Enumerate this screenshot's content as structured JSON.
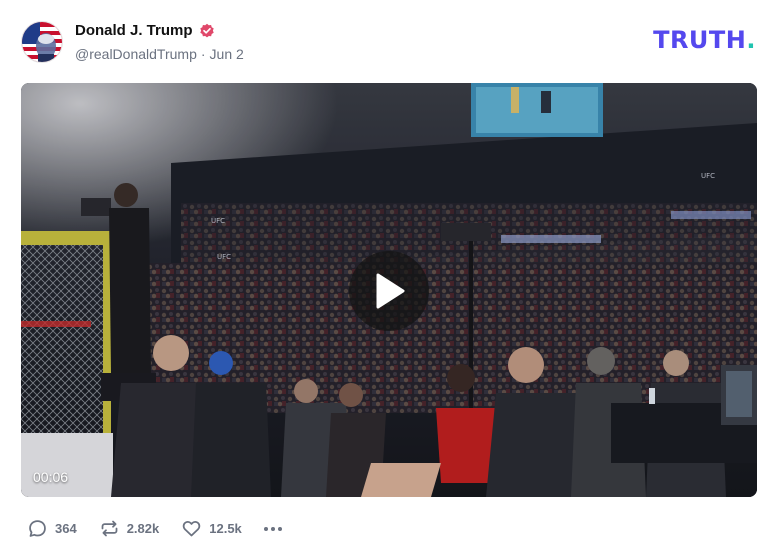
{
  "author": {
    "display_name": "Donald J. Trump",
    "handle": "@realDonaldTrump",
    "separator": "·",
    "date": "Jun 2",
    "verified_icon": "verified-badge-icon"
  },
  "brand": {
    "logo_text": "TRUTH",
    "logo_dot": ".",
    "color": "#5448ee",
    "dot_color": "#20c4b0"
  },
  "video": {
    "duration": "00:06",
    "play_icon": "play-icon"
  },
  "actions": {
    "replies": "364",
    "retruths": "2.82k",
    "likes": "12.5k"
  }
}
